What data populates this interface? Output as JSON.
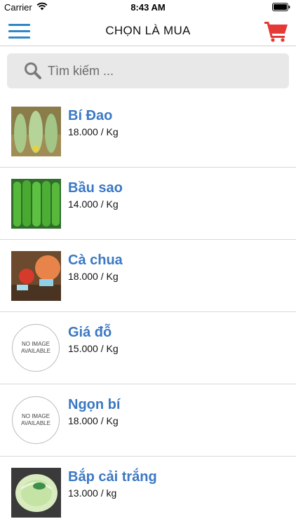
{
  "status_bar": {
    "carrier": "Carrier",
    "time": "8:43 AM"
  },
  "nav": {
    "title": "CHỌN LÀ MUA",
    "menu_icon": "hamburger-menu-icon",
    "cart_icon": "shopping-cart-icon"
  },
  "search": {
    "placeholder": "Tìm kiếm ...",
    "value": "",
    "icon": "search-icon"
  },
  "colors": {
    "accent": "#2f86c9",
    "product_name": "#3b78c4",
    "cart": "#e53935",
    "search_bg": "#e8e8e8"
  },
  "products": [
    {
      "name": "Bí Đao",
      "price": "18.000 / Kg"
    },
    {
      "name": "Bầu sao",
      "price": "14.000 / Kg"
    },
    {
      "name": "Cà chua",
      "price": "18.000 / Kg"
    },
    {
      "name": "Giá đỗ",
      "price": "15.000 / Kg",
      "image_text": "NO IMAGE AVAILABLE"
    },
    {
      "name": "Ngọn bí",
      "price": "18.000 / Kg",
      "image_text": "NO IMAGE AVAILABLE"
    },
    {
      "name": "Bắp cải trắng",
      "price": "13.000 / kg"
    }
  ]
}
